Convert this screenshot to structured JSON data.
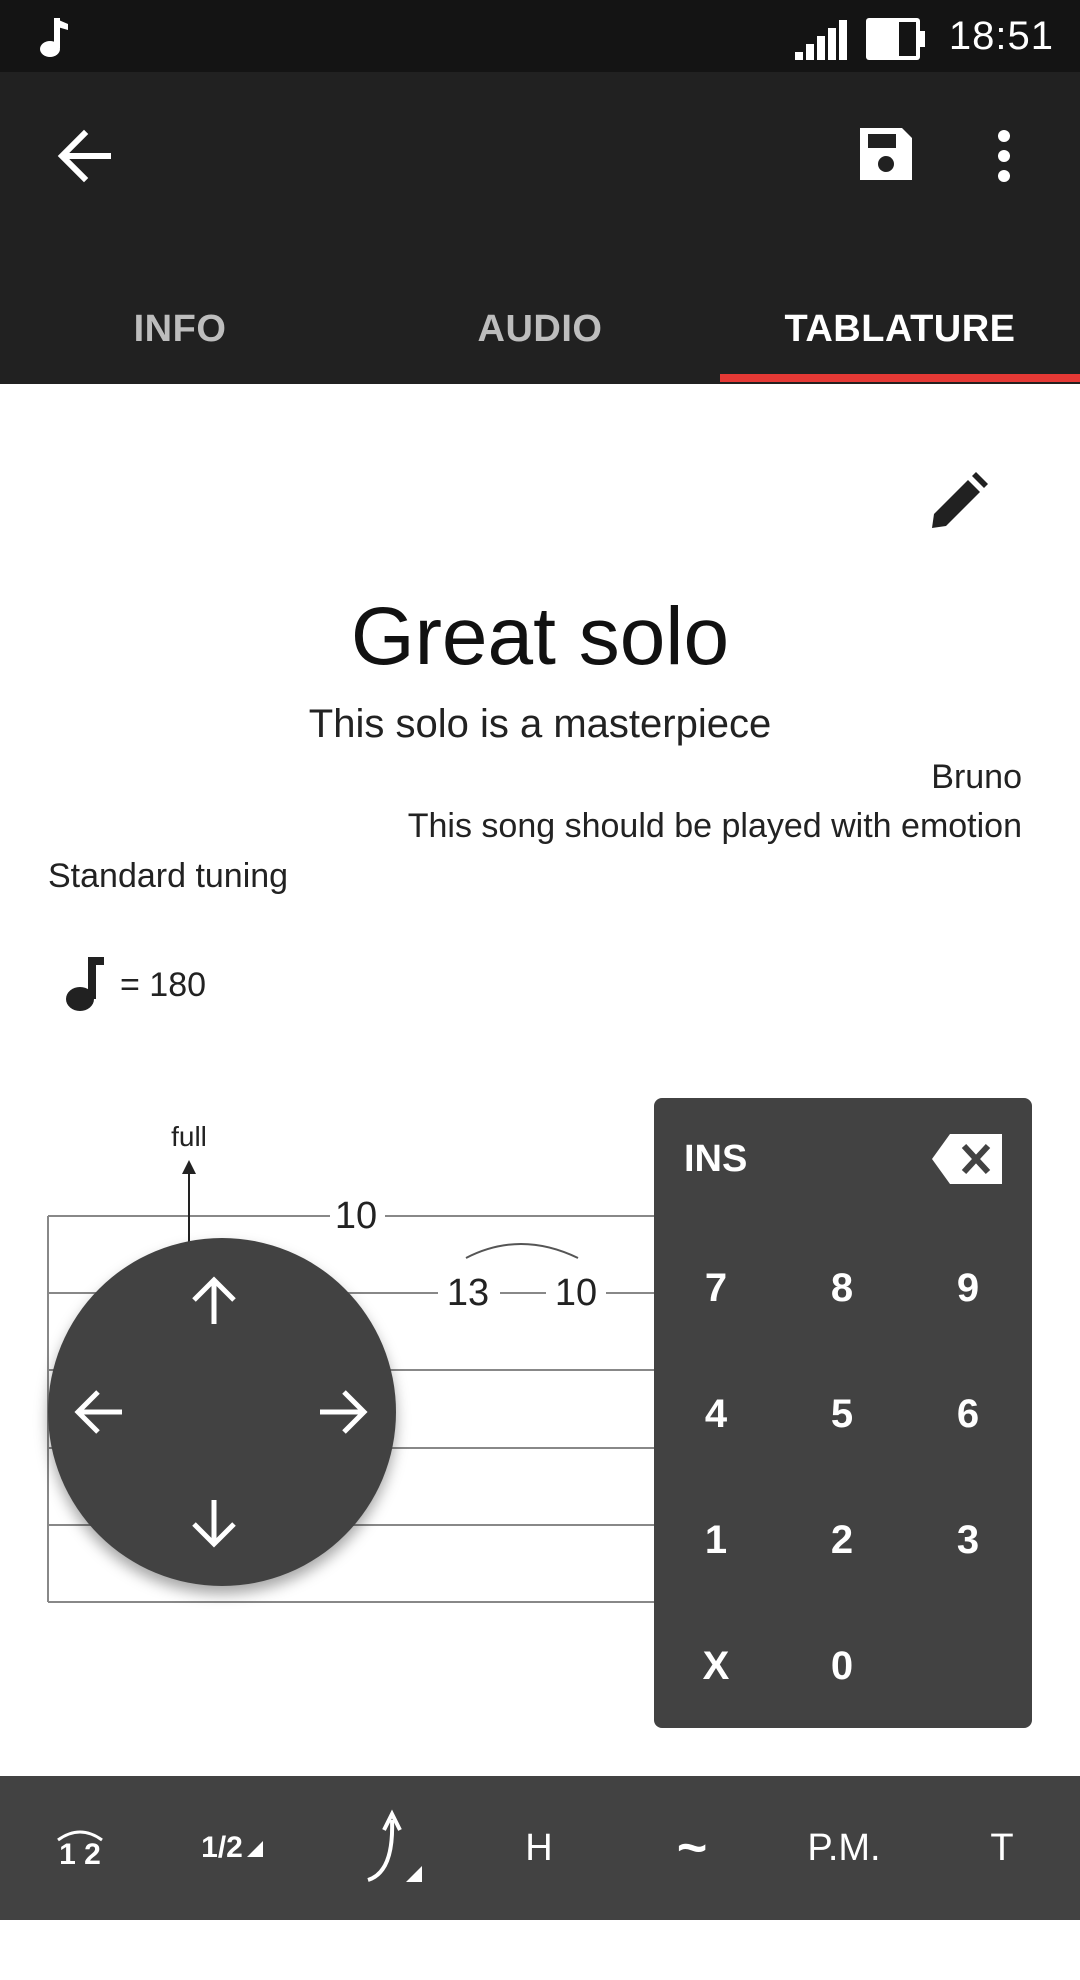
{
  "status_bar": {
    "time": "18:51"
  },
  "tabs": [
    {
      "label": "INFO"
    },
    {
      "label": "AUDIO"
    },
    {
      "label": "TABLATURE"
    }
  ],
  "song": {
    "title": "Great solo",
    "subtitle": "This solo is a masterpiece",
    "author": "Bruno",
    "instructions": "This song should be played with emotion",
    "tuning": "Standard tuning",
    "tempo": "= 180"
  },
  "tab_notation": {
    "bend_label": "full",
    "fret_a": "10",
    "fret_b": "13",
    "fret_c": "10"
  },
  "numpad": {
    "mode": "INS",
    "keys": [
      "7",
      "8",
      "9",
      "4",
      "5",
      "6",
      "1",
      "2",
      "3",
      "X",
      "0"
    ]
  },
  "toolbar": {
    "slur": "1 2",
    "half": "1/2",
    "hammer": "H",
    "vibrato": "~",
    "palm_mute": "P.M.",
    "tap": "T"
  },
  "colors": {
    "accent": "#e53935",
    "appbar": "#212121",
    "panel": "#424242"
  }
}
